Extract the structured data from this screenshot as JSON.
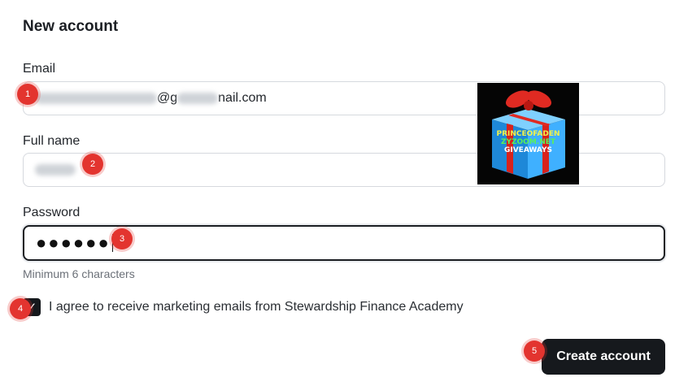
{
  "form": {
    "title": "New account",
    "email": {
      "label": "Email",
      "value_visible": "@g",
      "value_visible_end": "nail.com"
    },
    "full_name": {
      "label": "Full name"
    },
    "password": {
      "label": "Password",
      "value_masked": "●●●●●●",
      "hint": "Minimum 6 characters"
    },
    "consent": {
      "checked": true,
      "check_glyph": "✓",
      "label": "I agree to receive marketing emails from Stewardship Finance Academy"
    },
    "submit_label": "Create account"
  },
  "annotations": [
    "1",
    "2",
    "3",
    "4",
    "5"
  ],
  "promo_image": {
    "line1": "PRINCEOFADEN",
    "line2": "ZYZOOM.NET",
    "line3": "GIVEAWAYS"
  },
  "colors": {
    "accent": "#16191d",
    "marker": "#e3342f"
  }
}
